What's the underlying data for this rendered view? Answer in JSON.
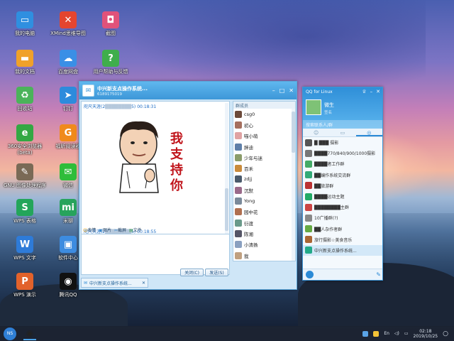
{
  "desktop": {
    "icons": [
      {
        "label": "我的电脑",
        "icon": "computer-icon",
        "glyph": "▭",
        "color": "#2f8fe0"
      },
      {
        "label": "我的文档",
        "icon": "folder-icon",
        "glyph": "▬",
        "color": "#f0a12a"
      },
      {
        "label": "回收站",
        "icon": "recycle-bin-icon",
        "glyph": "♻",
        "color": "#4bb35a"
      },
      {
        "label": "360安全浏览器 (beta)",
        "icon": "browser-360-icon",
        "glyph": "e",
        "color": "#33a843"
      },
      {
        "label": "GNU 图像处理程序",
        "icon": "gimp-icon",
        "glyph": "✎",
        "color": "#7a6a56"
      },
      {
        "label": "WPS 表格",
        "icon": "wps-sheet-icon",
        "glyph": "S",
        "color": "#23a55a"
      },
      {
        "label": "WPS 文字",
        "icon": "wps-writer-icon",
        "glyph": "W",
        "color": "#2e7bd8"
      },
      {
        "label": "WPS 演示",
        "icon": "wps-presentation-icon",
        "glyph": "P",
        "color": "#e2622b"
      },
      {
        "label": "XMind思维导图",
        "icon": "xmind-icon",
        "glyph": "✕",
        "color": "#e4452f"
      },
      {
        "label": "百度网盘",
        "icon": "baidu-netdisk-icon",
        "glyph": "☁",
        "color": "#3a8fe6"
      },
      {
        "label": "钉钉",
        "icon": "dingtalk-icon",
        "glyph": "➤",
        "color": "#2d8bdc"
      },
      {
        "label": "福昕阅读器",
        "icon": "foxit-reader-icon",
        "glyph": "G",
        "color": "#f08a1c"
      },
      {
        "label": "微信",
        "icon": "wechat-icon",
        "glyph": "✉",
        "color": "#2fbd3a"
      },
      {
        "label": "米聊",
        "icon": "miliao-icon",
        "glyph": "mi",
        "color": "#27a35c"
      },
      {
        "label": "软件中心",
        "icon": "software-center-icon",
        "glyph": "▣",
        "color": "#3d8ce0"
      },
      {
        "label": "腾讯QQ",
        "icon": "tencent-qq-icon",
        "glyph": "◉",
        "color": "#111"
      },
      {
        "label": "截图",
        "icon": "screenshot-icon",
        "glyph": "◘",
        "color": "#e0527a"
      },
      {
        "label": "用户帮助与反馈",
        "icon": "help-feedback-icon",
        "glyph": "?",
        "color": "#3fae4c"
      }
    ]
  },
  "chat": {
    "title": "中兴新支点操作系统...",
    "group_id": "6189175019",
    "messages": [
      {
        "sender": "咫尺天涯(2",
        "masked": "████████",
        "suffix": "5)",
        "time": "00:18:31",
        "sticker_text": [
          "我",
          "支",
          "持",
          "你"
        ]
      },
      {
        "sender": "咫尺天涯(2",
        "masked": "████████",
        "suffix": "5)",
        "time": "00:18:55",
        "emoji": "👍"
      }
    ],
    "toolbar": [
      "表情",
      "图片",
      "截屏",
      "文件"
    ],
    "close_label": "关闭(C)",
    "send_label": "发送(S)",
    "tab_label": "中兴新支点操作系统...",
    "members_header": "群成员",
    "members": [
      "csg0",
      "初心",
      "喵小萌",
      "胖迪",
      "少年与迷",
      "百禾",
      "zdjj",
      "沉默",
      "Yong",
      "园中花",
      "衍渡",
      "陈湘",
      "小清扬",
      "我",
      "~不断桥烟雨~"
    ]
  },
  "qq": {
    "title": "QQ for Linux",
    "nickname": "微生",
    "signature": "签名",
    "search_placeholder": "搜索联系人/群",
    "tabs": [
      "☺",
      "▭",
      "◎"
    ],
    "list": [
      {
        "name": "█ ███ 摄影",
        "color": "#555"
      },
      {
        "name": "████770/840/900/1000摄影",
        "color": "#777"
      },
      {
        "name": "████者工作群",
        "color": "#4a6"
      },
      {
        "name": "██编作系统交流群",
        "color": "#3a7"
      },
      {
        "name": "██旅游群",
        "color": "#b33"
      },
      {
        "name": "████运动主题",
        "color": "#2a6"
      },
      {
        "name": "████████主群",
        "color": "#c44"
      },
      {
        "name": "10广播群(?)",
        "color": "#888"
      },
      {
        "name": "██人杂作者群",
        "color": "#6a4"
      },
      {
        "name": "旅行摄影☆美食音乐",
        "color": "#a63"
      },
      {
        "name": "中兴新支点操作系统...",
        "color": "#2a8"
      }
    ]
  },
  "taskbar": {
    "start_label": "NS",
    "lang": "En",
    "time": "02:18",
    "date": "2019/10/25"
  }
}
